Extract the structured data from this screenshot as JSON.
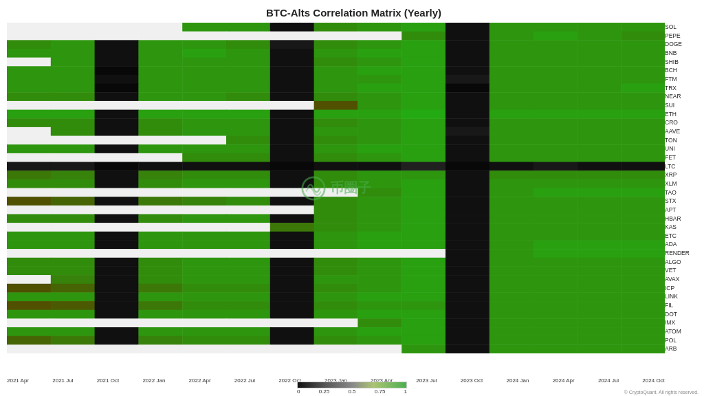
{
  "title": "BTC-Alts Correlation Matrix (Yearly)",
  "y_labels": [
    "SOL",
    "PEPE",
    "DOGE",
    "BNB",
    "SHIB",
    "BCH",
    "FTM",
    "TRX",
    "NEAR",
    "SUI",
    "ETH",
    "CRO",
    "AAVE",
    "TON",
    "UNI",
    "FET",
    "LTC",
    "XRP",
    "XLM",
    "TAO",
    "STX",
    "APT",
    "HBAR",
    "KAS",
    "ETC",
    "ADA",
    "RENDER",
    "ALGO",
    "VET",
    "AVAX",
    "ICP",
    "LINK",
    "FIL",
    "DOT",
    "IMX",
    "ATOM",
    "POL",
    "ARB"
  ],
  "x_labels": [
    "2021 Apr",
    "2021 Jul",
    "2021 Oct",
    "2022 Jan",
    "2022 Apr",
    "2022 Jul",
    "2022 Oct",
    "2023 Jan",
    "2023 Apr",
    "2023 Jul",
    "2023 Oct",
    "2024 Jan",
    "2024 Apr",
    "2024 Jul",
    "2024 Oct"
  ],
  "legend": {
    "values": [
      "0",
      "0.25",
      "0.5",
      "0.75",
      "1"
    ]
  },
  "watermark": {
    "text": "币圈子"
  },
  "copyright": "© CryptoQuant. All rights reserved."
}
